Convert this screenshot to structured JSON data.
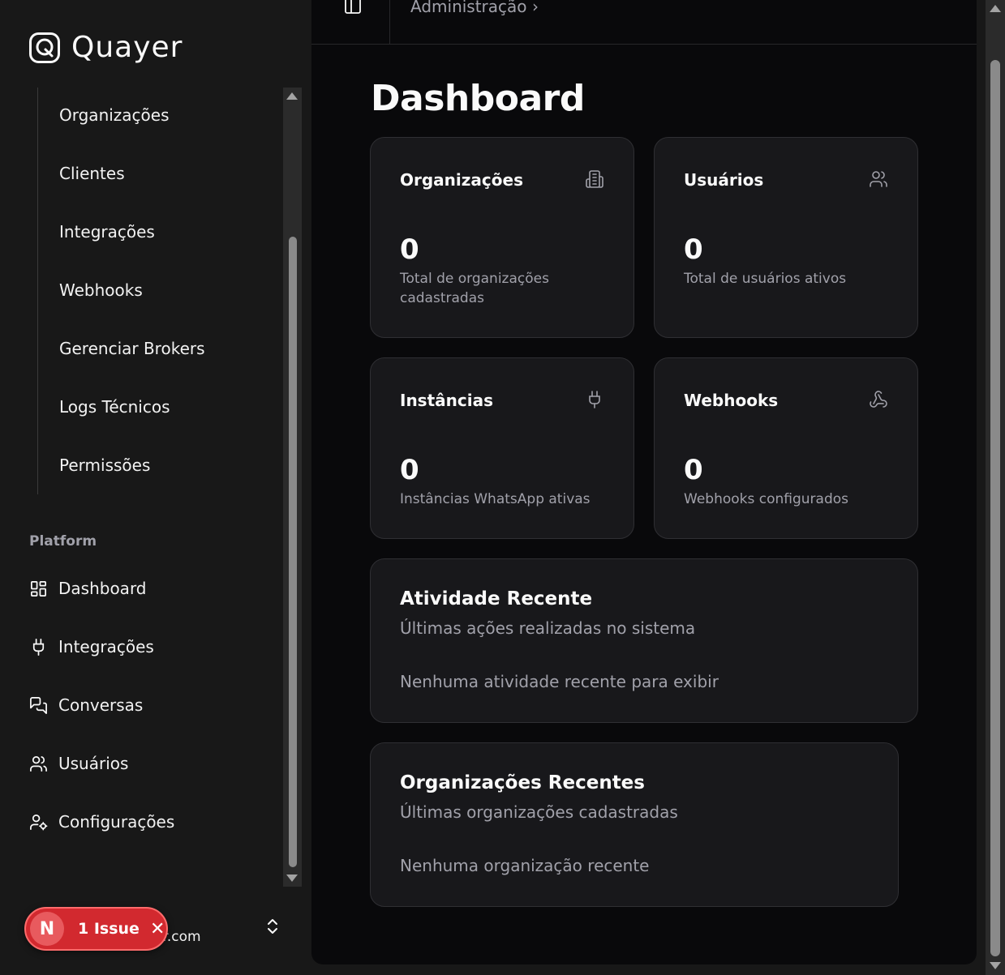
{
  "sidebar": {
    "brand": "Quayer",
    "sub_items": [
      {
        "label": "Organizações"
      },
      {
        "label": "Clientes"
      },
      {
        "label": "Integrações"
      },
      {
        "label": "Webhooks"
      },
      {
        "label": "Gerenciar Brokers"
      },
      {
        "label": "Logs Técnicos"
      },
      {
        "label": "Permissões"
      }
    ],
    "section_label": "Platform",
    "nav_items": [
      {
        "label": "Dashboard",
        "icon": "layout-dashboard-icon"
      },
      {
        "label": "Integrações",
        "icon": "plug-icon"
      },
      {
        "label": "Conversas",
        "icon": "messages-icon"
      },
      {
        "label": "Usuários",
        "icon": "users-icon"
      },
      {
        "label": "Configurações",
        "icon": "user-cog-icon"
      }
    ],
    "user_email_visible": "er.com"
  },
  "issue_badge": {
    "initial": "N",
    "label": "1 Issue",
    "close": "✕",
    "color": "#d2292f"
  },
  "header": {
    "breadcrumb": "Administração",
    "separator": "›"
  },
  "page": {
    "title": "Dashboard"
  },
  "stats": [
    {
      "title": "Organizações",
      "value": "0",
      "description": "Total de organizações cadastradas",
      "icon": "building-icon"
    },
    {
      "title": "Usuários",
      "value": "0",
      "description": "Total de usuários ativos",
      "icon": "users-icon"
    },
    {
      "title": "Instâncias",
      "value": "0",
      "description": "Instâncias WhatsApp ativas",
      "icon": "plug-icon"
    },
    {
      "title": "Webhooks",
      "value": "0",
      "description": "Webhooks configurados",
      "icon": "webhook-icon"
    }
  ],
  "recent_activity": {
    "title": "Atividade Recente",
    "subtitle": "Últimas ações realizadas no sistema",
    "empty": "Nenhuma atividade recente para exibir"
  },
  "recent_orgs": {
    "title": "Organizações Recentes",
    "subtitle": "Últimas organizações cadastradas",
    "empty": "Nenhuma organização recente"
  }
}
